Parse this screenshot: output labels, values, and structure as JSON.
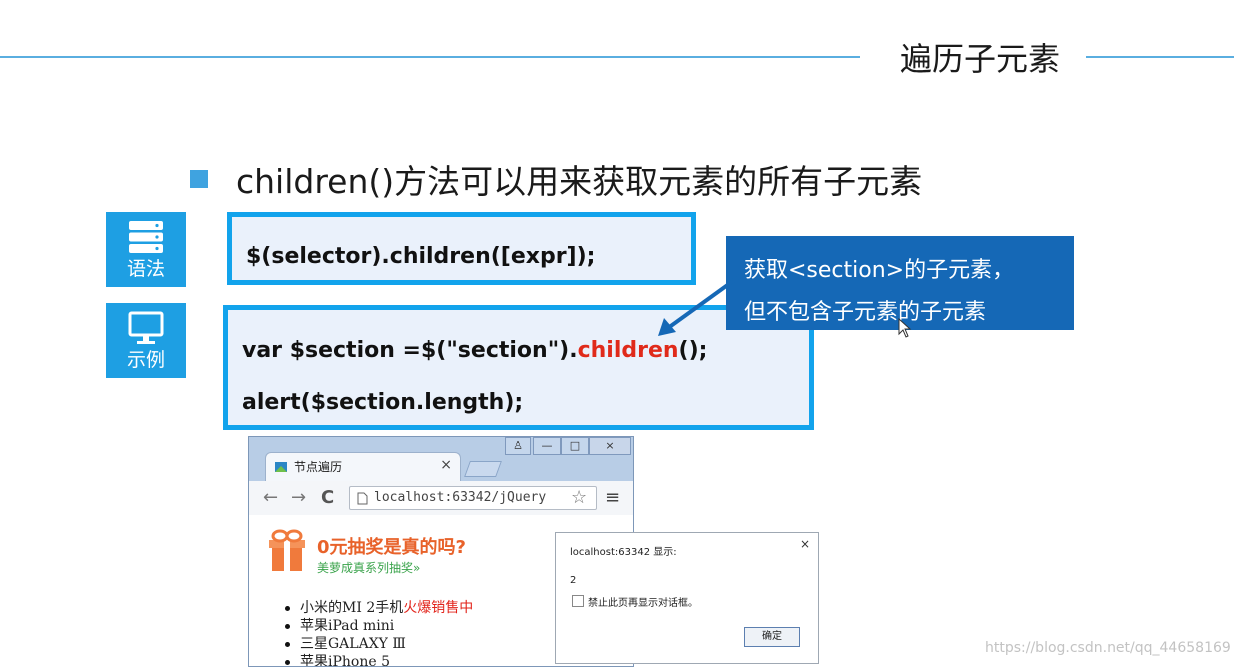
{
  "slide": {
    "title": "遍历子元素",
    "bullet": "children()方法可以用来获取元素的所有子元素",
    "side_tiles": [
      {
        "label": "语法",
        "icon": "server-stack-icon"
      },
      {
        "label": "示例",
        "icon": "monitor-icon"
      }
    ],
    "syntax_code": "$(selector).children([expr]);",
    "example": {
      "line1_prefix": "var $section =$(\"section\").",
      "line1_method": "children",
      "line1_suffix": "();",
      "line2": "alert($section.length);"
    },
    "callout": {
      "line1": "获取<section>的子元素，",
      "line2": "但不包含子元素的子元素"
    },
    "colors": {
      "accent": "#12a3ec",
      "tile": "#1e9fe3",
      "callout": "#1568b6",
      "highlight": "#e02a1a"
    }
  },
  "browser": {
    "tab_title": "节点遍历",
    "tab_close": "×",
    "address": "localhost:63342/jQuery",
    "nav": {
      "back": "←",
      "forward": "→",
      "reload": "C",
      "menu": "≡",
      "star": "☆"
    },
    "window_buttons": [
      "♙",
      "—",
      "□",
      "×"
    ],
    "promo_title": "0元抽奖是真的吗?",
    "promo_sub": "美萝成真系列抽奖»",
    "list_items": [
      {
        "text": "小米的MI 2手机",
        "highlight": "火爆销售中"
      },
      {
        "text": "苹果iPad mini",
        "highlight": ""
      },
      {
        "text": "三星GALAXY Ⅲ",
        "highlight": ""
      },
      {
        "text": "苹果iPhone 5",
        "highlight": ""
      }
    ]
  },
  "alert_dialog": {
    "title": "localhost:63342 显示:",
    "message": "2",
    "checkbox_label": "禁止此页再显示对话框。",
    "ok_label": "确定",
    "close": "×"
  },
  "watermark": "https://blog.csdn.net/qq_44658169"
}
